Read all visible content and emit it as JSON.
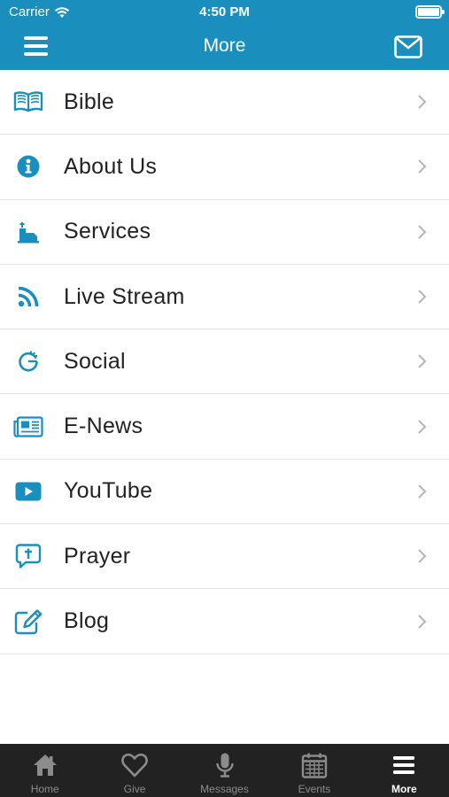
{
  "status_bar": {
    "carrier": "Carrier",
    "time": "4:50 PM"
  },
  "nav": {
    "title": "More"
  },
  "menu": [
    {
      "label": "Bible",
      "icon": "book-icon"
    },
    {
      "label": "About Us",
      "icon": "info-icon"
    },
    {
      "label": "Services",
      "icon": "pulpit-icon"
    },
    {
      "label": "Live Stream",
      "icon": "rss-icon"
    },
    {
      "label": "Social",
      "icon": "social-icon"
    },
    {
      "label": "E-News",
      "icon": "newspaper-icon"
    },
    {
      "label": "YouTube",
      "icon": "youtube-icon"
    },
    {
      "label": "Prayer",
      "icon": "prayer-icon"
    },
    {
      "label": "Blog",
      "icon": "edit-icon"
    }
  ],
  "tabs": [
    {
      "label": "Home",
      "icon": "home-icon"
    },
    {
      "label": "Give",
      "icon": "heart-icon"
    },
    {
      "label": "Messages",
      "icon": "microphone-icon"
    },
    {
      "label": "Events",
      "icon": "calendar-icon"
    },
    {
      "label": "More",
      "icon": "menu-icon",
      "active": true
    }
  ],
  "colors": {
    "accent": "#1a8fbd",
    "tabbar": "#222222",
    "tab_inactive": "#8c8c8c"
  }
}
